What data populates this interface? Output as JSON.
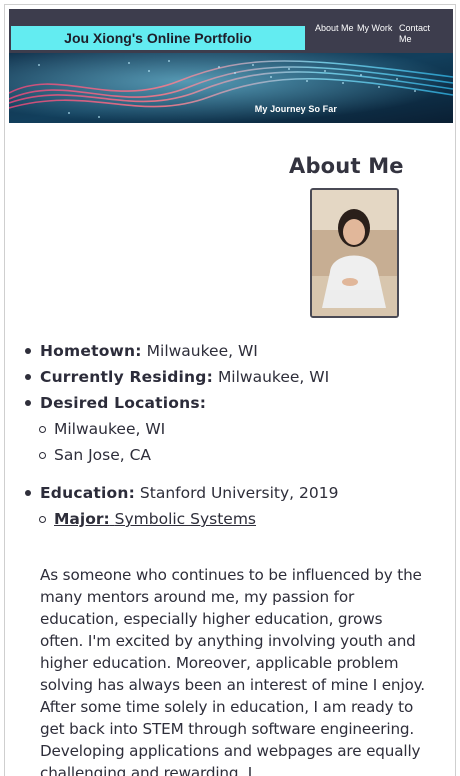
{
  "header": {
    "site_title": "Jou Xiong's Online Portfolio",
    "nav": [
      "About Me",
      "My Work",
      "Contact Me"
    ],
    "banner_caption": "My Journey So Far"
  },
  "main": {
    "section_title": "About Me",
    "facts": {
      "hometown_label": "Hometown:",
      "hometown_value": "Milwaukee, WI",
      "residing_label": "Currently Residing:",
      "residing_value": "Milwaukee, WI",
      "desired_label": "Desired Locations:",
      "desired_locations": [
        "Milwaukee, WI",
        "San Jose, CA"
      ],
      "education_label": "Education:",
      "education_value": "Stanford University, 2019",
      "major_label": "Major:",
      "major_value": "Symbolic Systems"
    },
    "bio": "As someone who continues to be influenced by the many mentors around me, my passion for education, especially higher education, grows often. I'm excited by anything involving youth and higher education. Moreover, applicable problem solving has always been an interest of mine I enjoy. After some time solely in education, I am ready to get back into STEM through software engineering. Developing applications and webpages are equally challenging and rewarding. I"
  }
}
